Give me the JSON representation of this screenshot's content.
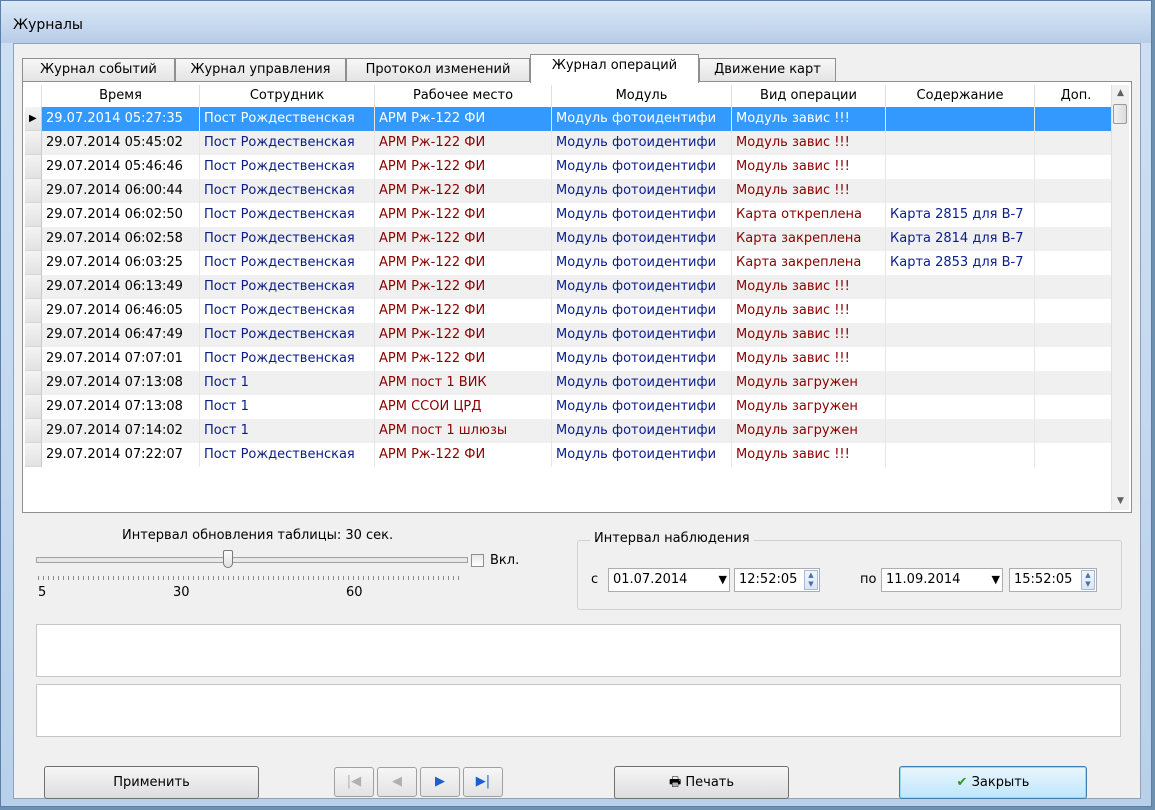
{
  "window": {
    "title": "Журналы"
  },
  "tabs": [
    {
      "label": "Журнал событий",
      "active": false
    },
    {
      "label": "Журнал управления",
      "active": false
    },
    {
      "label": "Протокол изменений",
      "active": false
    },
    {
      "label": "Журнал операций",
      "active": true
    },
    {
      "label": "Движение карт",
      "active": false
    }
  ],
  "table": {
    "columns": [
      "Время",
      "Сотрудник",
      "Рабочее место",
      "Модуль",
      "Вид операции",
      "Содержание",
      "Доп."
    ],
    "rows": [
      [
        "29.07.2014 05:27:35",
        "Пост Рождественская",
        "АРМ Рж-122 ФИ",
        "Модуль фотоидентифи",
        "Модуль завис !!!",
        "",
        ""
      ],
      [
        "29.07.2014 05:45:02",
        "Пост Рождественская",
        "АРМ Рж-122 ФИ",
        "Модуль фотоидентифи",
        "Модуль завис !!!",
        "",
        ""
      ],
      [
        "29.07.2014 05:46:46",
        "Пост Рождественская",
        "АРМ Рж-122 ФИ",
        "Модуль фотоидентифи",
        "Модуль завис !!!",
        "",
        ""
      ],
      [
        "29.07.2014 06:00:44",
        "Пост Рождественская",
        "АРМ Рж-122 ФИ",
        "Модуль фотоидентифи",
        "Модуль завис !!!",
        "",
        ""
      ],
      [
        "29.07.2014 06:02:50",
        "Пост Рождественская",
        "АРМ Рж-122 ФИ",
        "Модуль фотоидентифи",
        "Карта откреплена",
        "Карта 2815 для В-7",
        ""
      ],
      [
        "29.07.2014 06:02:58",
        "Пост Рождественская",
        "АРМ Рж-122 ФИ",
        "Модуль фотоидентифи",
        "Карта закреплена",
        "Карта 2814 для В-7",
        ""
      ],
      [
        "29.07.2014 06:03:25",
        "Пост Рождественская",
        "АРМ Рж-122 ФИ",
        "Модуль фотоидентифи",
        "Карта закреплена",
        "Карта 2853 для В-7",
        ""
      ],
      [
        "29.07.2014 06:13:49",
        "Пост Рождественская",
        "АРМ Рж-122 ФИ",
        "Модуль фотоидентифи",
        "Модуль завис !!!",
        "",
        ""
      ],
      [
        "29.07.2014 06:46:05",
        "Пост Рождественская",
        "АРМ Рж-122 ФИ",
        "Модуль фотоидентифи",
        "Модуль завис !!!",
        "",
        ""
      ],
      [
        "29.07.2014 06:47:49",
        "Пост Рождественская",
        "АРМ Рж-122 ФИ",
        "Модуль фотоидентифи",
        "Модуль завис !!!",
        "",
        ""
      ],
      [
        "29.07.2014 07:07:01",
        "Пост Рождественская",
        "АРМ Рж-122 ФИ",
        "Модуль фотоидентифи",
        "Модуль завис !!!",
        "",
        ""
      ],
      [
        "29.07.2014 07:13:08",
        "Пост 1",
        "АРМ пост 1 ВИК",
        "Модуль фотоидентифи",
        "Модуль загружен",
        "",
        ""
      ],
      [
        "29.07.2014 07:13:08",
        "Пост 1",
        "АРМ ССОИ ЦРД",
        "Модуль фотоидентифи",
        "Модуль загружен",
        "",
        ""
      ],
      [
        "29.07.2014 07:14:02",
        "Пост 1",
        "АРМ пост 1 шлюзы",
        "Модуль фотоидентифи",
        "Модуль загружен",
        "",
        ""
      ],
      [
        "29.07.2014 07:22:07",
        "Пост Рождественская",
        "АРМ Рж-122 ФИ",
        "Модуль фотоидентифи",
        "Модуль завис !!!",
        "",
        ""
      ]
    ],
    "selected_row": 0
  },
  "refresh": {
    "label": "Интервал обновления таблицы: 30 сек.",
    "value": 30,
    "scale_labels": [
      "5",
      "30",
      "60"
    ],
    "enabled_label": "Вкл.",
    "enabled": false
  },
  "observation": {
    "legend": "Интервал наблюдения",
    "from_label": "с",
    "from_date": "01.07.2014",
    "from_time": "12:52:05",
    "to_label": "по",
    "to_date": "11.09.2014",
    "to_time": "15:52:05"
  },
  "buttons": {
    "apply": "Применить",
    "print": "Печать",
    "close": "Закрыть"
  },
  "colors": {
    "selection": "#3399ff",
    "employee_text": "#0b1c8c",
    "workplace_text": "#8b0000"
  }
}
